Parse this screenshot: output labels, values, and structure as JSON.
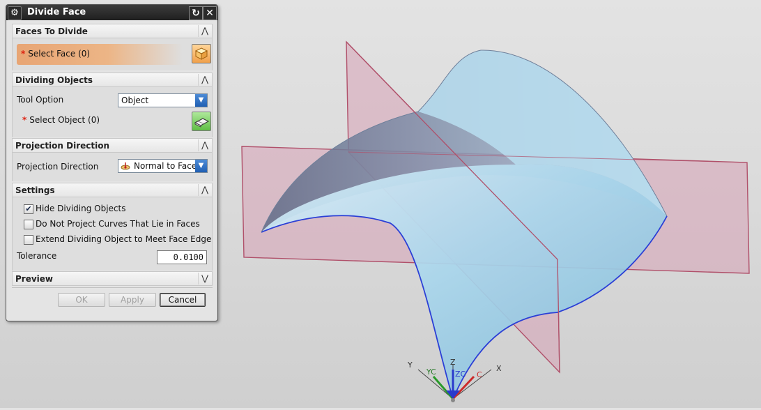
{
  "dialog": {
    "title": "Divide Face",
    "sections": {
      "faces_to_divide": {
        "header": "Faces To Divide",
        "select_face_label": "Select Face (0)",
        "required_marker": "*"
      },
      "dividing_objects": {
        "header": "Dividing Objects",
        "tool_option_label": "Tool Option",
        "tool_option_value": "Object",
        "select_object_label": "Select Object (0)",
        "required_marker": "*"
      },
      "projection_direction": {
        "header": "Projection Direction",
        "label": "Projection Direction",
        "value": "Normal to Face"
      },
      "settings": {
        "header": "Settings",
        "hide_dividing_objects": {
          "label": "Hide Dividing Objects",
          "checked": true
        },
        "do_not_project_curves": {
          "label": "Do Not Project Curves That Lie in Faces",
          "checked": false
        },
        "extend_dividing_object": {
          "label": "Extend Dividing Object to Meet Face Edge",
          "checked": false
        },
        "tolerance_label": "Tolerance",
        "tolerance_value": "0.0100"
      },
      "preview": {
        "header": "Preview"
      }
    },
    "buttons": {
      "ok": "OK",
      "apply": "Apply",
      "cancel": "Cancel"
    }
  },
  "triad": {
    "y": "Y",
    "yc": "YC",
    "z": "Z",
    "zc": "ZC",
    "x": "X",
    "xc": "C"
  },
  "colors": {
    "surface": "#9fd0ea",
    "surface_edge": "#2b3fd6",
    "plane_fill": "#d7a3b6",
    "plane_edge": "#b0506a",
    "select_highlight": "#e8a574"
  }
}
